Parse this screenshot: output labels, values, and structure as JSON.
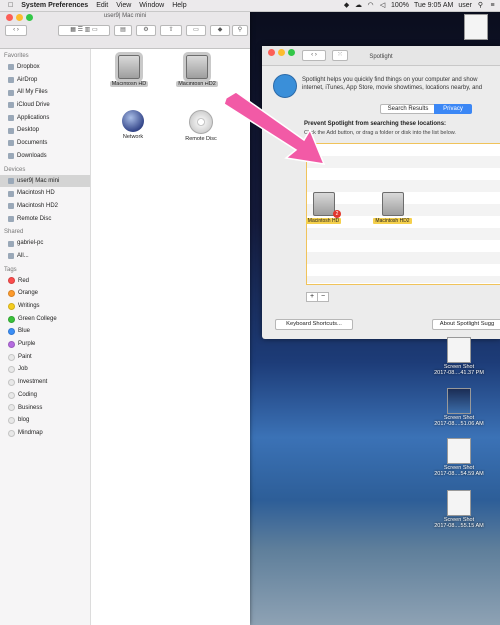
{
  "menubar": {
    "app_name": "System Preferences",
    "menus": [
      "Edit",
      "View",
      "Window",
      "Help"
    ],
    "percent": "100%",
    "time": "Tue 9:05 AM",
    "user": "user"
  },
  "finder": {
    "title": "user9| Mac mini",
    "sidebar": {
      "favorites_header": "Favorites",
      "favorites": [
        "Dropbox",
        "AirDrop",
        "All My Files",
        "iCloud Drive",
        "Applications",
        "Desktop",
        "Documents",
        "Downloads"
      ],
      "devices_header": "Devices",
      "devices": [
        "user9| Mac mini",
        "Macintosh HD",
        "Macintosh HD2",
        "Remote Disc"
      ],
      "shared_header": "Shared",
      "shared": [
        "gabriel-pc",
        "All..."
      ],
      "tags_header": "Tags",
      "tags": [
        {
          "label": "Red",
          "color": "#fc4d4d"
        },
        {
          "label": "Orange",
          "color": "#fd9a2c"
        },
        {
          "label": "Writings",
          "color": "#f6cd1f"
        },
        {
          "label": "Green College",
          "color": "#3ac13a"
        },
        {
          "label": "Blue",
          "color": "#3a8ef6"
        },
        {
          "label": "Purple",
          "color": "#b56be0"
        },
        {
          "label": "Paint",
          "color": "#e8e8e8"
        },
        {
          "label": "Job",
          "color": "#e8e8e8"
        },
        {
          "label": "Investment",
          "color": "#e8e8e8"
        },
        {
          "label": "Coding",
          "color": "#e8e8e8"
        },
        {
          "label": "Business",
          "color": "#e8e8e8"
        },
        {
          "label": "blog",
          "color": "#e8e8e8"
        },
        {
          "label": "Mindmap",
          "color": "#e8e8e8"
        }
      ]
    },
    "items": [
      "Macintosh HD",
      "Macintosh HD2",
      "Network",
      "Remote Disc"
    ]
  },
  "spotlight": {
    "title": "Spotlight",
    "description": "Spotlight helps you quickly find things on your computer and show\ninternet, iTunes, App Store, movie showtimes, locations nearby, and",
    "tab_results": "Search Results",
    "tab_privacy": "Privacy",
    "prevent_title": "Prevent Spotlight from searching these locations:",
    "prevent_sub": "Click the Add button, or drag a folder or disk into the list below.",
    "list_items": [
      "Macintosh HD",
      "Macintosh HD2"
    ],
    "badge": "2",
    "add": "+",
    "remove": "−",
    "keyboard_button": "Keyboard Shortcuts...",
    "about_button": "About Spotlight Sugg"
  },
  "desktop": [
    {
      "name": "Screen Shot",
      "date": "2017-08....41.37 PM"
    },
    {
      "name": "Screen Shot",
      "date": "2017-08....51.06 AM"
    },
    {
      "name": "Screen Shot",
      "date": "2017-08....54.59 AM"
    },
    {
      "name": "Screen Shot",
      "date": "2017-08....55.15 AM"
    }
  ]
}
